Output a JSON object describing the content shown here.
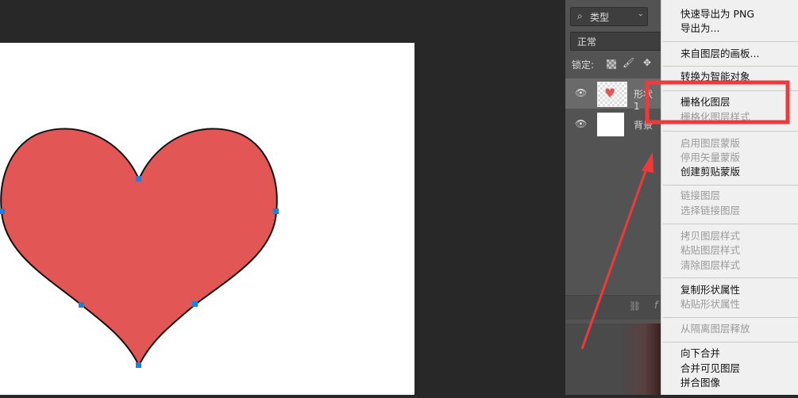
{
  "layers_panel": {
    "filter_label": "类型",
    "blend_mode": "正常",
    "lock_label": "锁定:",
    "layers": [
      {
        "name": "形状 1",
        "visible": true,
        "selected": true
      },
      {
        "name": "背景",
        "visible": true,
        "selected": false
      }
    ]
  },
  "context_menu": {
    "items": [
      {
        "label": "快速导出为 PNG",
        "enabled": true
      },
      {
        "label": "导出为...",
        "enabled": true
      },
      {
        "label": "来自图层的画板...",
        "enabled": true
      },
      {
        "label": "转换为智能对象",
        "enabled": true
      },
      {
        "label": "栅格化图层",
        "enabled": true
      },
      {
        "label": "栅格化图层样式",
        "enabled": false
      },
      {
        "label": "启用图层蒙版",
        "enabled": false
      },
      {
        "label": "停用矢量蒙版",
        "enabled": false
      },
      {
        "label": "创建剪贴蒙版",
        "enabled": true
      },
      {
        "label": "链接图层",
        "enabled": false
      },
      {
        "label": "选择链接图层",
        "enabled": false
      },
      {
        "label": "拷贝图层样式",
        "enabled": false
      },
      {
        "label": "粘贴图层样式",
        "enabled": false
      },
      {
        "label": "清除图层样式",
        "enabled": false
      },
      {
        "label": "复制形状属性",
        "enabled": true
      },
      {
        "label": "粘贴形状属性",
        "enabled": false
      },
      {
        "label": "从隔离图层释放",
        "enabled": false
      },
      {
        "label": "向下合并",
        "enabled": true
      },
      {
        "label": "合并可见图层",
        "enabled": true
      },
      {
        "label": "拼合图像",
        "enabled": true
      }
    ]
  },
  "colors": {
    "heart_fill": "#e25655",
    "annotation": "#f03a3a",
    "anchor": "#1e7fe0"
  }
}
